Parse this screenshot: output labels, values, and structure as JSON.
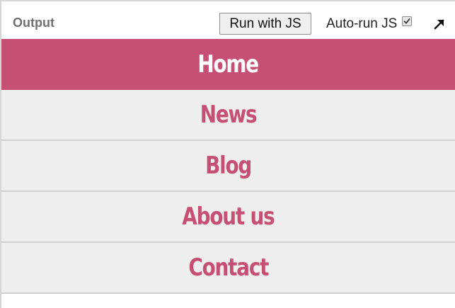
{
  "toolbar": {
    "output_label": "Output",
    "run_button_label": "Run with JS",
    "autorun_label": "Auto-run JS",
    "autorun_checked": true,
    "expand_icon": "arrow-up-right-icon"
  },
  "nav": {
    "active_index": 0,
    "items": [
      {
        "label": "Home"
      },
      {
        "label": "News"
      },
      {
        "label": "Blog"
      },
      {
        "label": "About us"
      },
      {
        "label": "Contact"
      }
    ]
  },
  "colors": {
    "accent": "#c65073",
    "nav_background": "#eeeeee",
    "divider": "#cfcfcf",
    "active_text": "#ffffff"
  }
}
